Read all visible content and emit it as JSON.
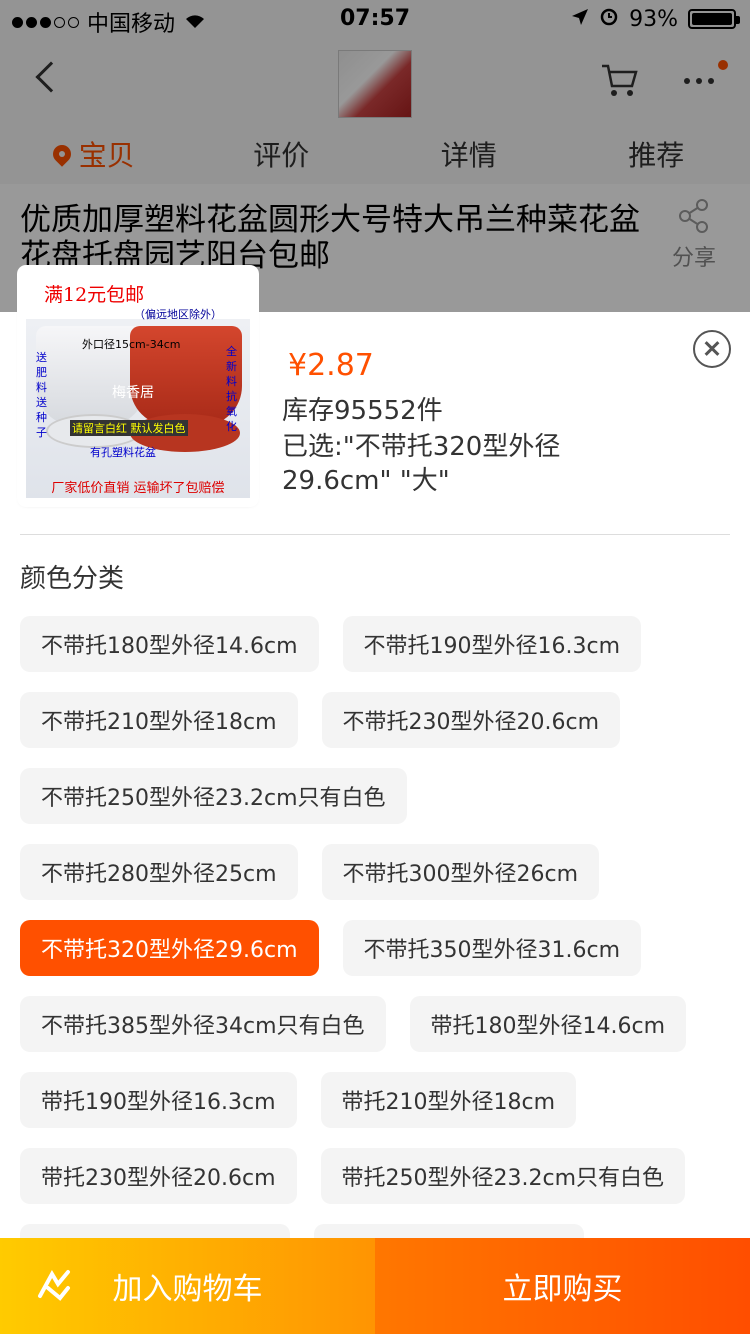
{
  "status_bar": {
    "carrier": "中国移动",
    "time": "07:57",
    "battery": "93%"
  },
  "tabs": [
    {
      "label": "宝贝"
    },
    {
      "label": "评价"
    },
    {
      "label": "详情"
    },
    {
      "label": "推荐"
    }
  ],
  "product": {
    "title": "优质加厚塑料花盆圆形大号特大吊兰种菜花盆花盘托盘园艺阳台包邮",
    "share_label": "分享"
  },
  "thumb": {
    "headline": "满12元包邮",
    "sub": "（偏远地区除外）",
    "size_text": "外口径15cm-34cm",
    "left_text": "送肥料送种子",
    "right_text": "全新料抗氧化",
    "brand": "梅香居",
    "note": "请留言白红 默认发白色",
    "hole": "有孔塑料花盆",
    "footer": "厂家低价直销 运输坏了包赔偿"
  },
  "sku": {
    "price": "¥2.87",
    "stock": "库存95552件",
    "selected": "已选:\"不带托320型外径29.6cm\" \"大\"",
    "section_label": "颜色分类"
  },
  "options": [
    [
      "不带托180型外径14.6cm",
      "不带托190型外径16.3cm"
    ],
    [
      "不带托210型外径18cm",
      "不带托230型外径20.6cm"
    ],
    [
      "不带托250型外径23.2cm只有白色"
    ],
    [
      "不带托280型外径25cm",
      "不带托300型外径26cm"
    ],
    [
      "不带托320型外径29.6cm",
      "不带托350型外径31.6cm"
    ],
    [
      "不带托385型外径34cm只有白色",
      "带托180型外径14.6cm"
    ],
    [
      "带托190型外径16.3cm",
      "带托210型外径18cm"
    ],
    [
      "带托230型外径20.6cm",
      "带托250型外径23.2cm只有白色"
    ]
  ],
  "selected_option": "不带托320型外径29.6cm",
  "bottom": {
    "cart_label": "加入购物车",
    "buy_label": "立即购买"
  },
  "colors": {
    "accent": "#ff5000",
    "cart_gradient": [
      "#ffcb00",
      "#ff9402"
    ],
    "buy_gradient": [
      "#ff7700",
      "#ff4e00"
    ]
  }
}
